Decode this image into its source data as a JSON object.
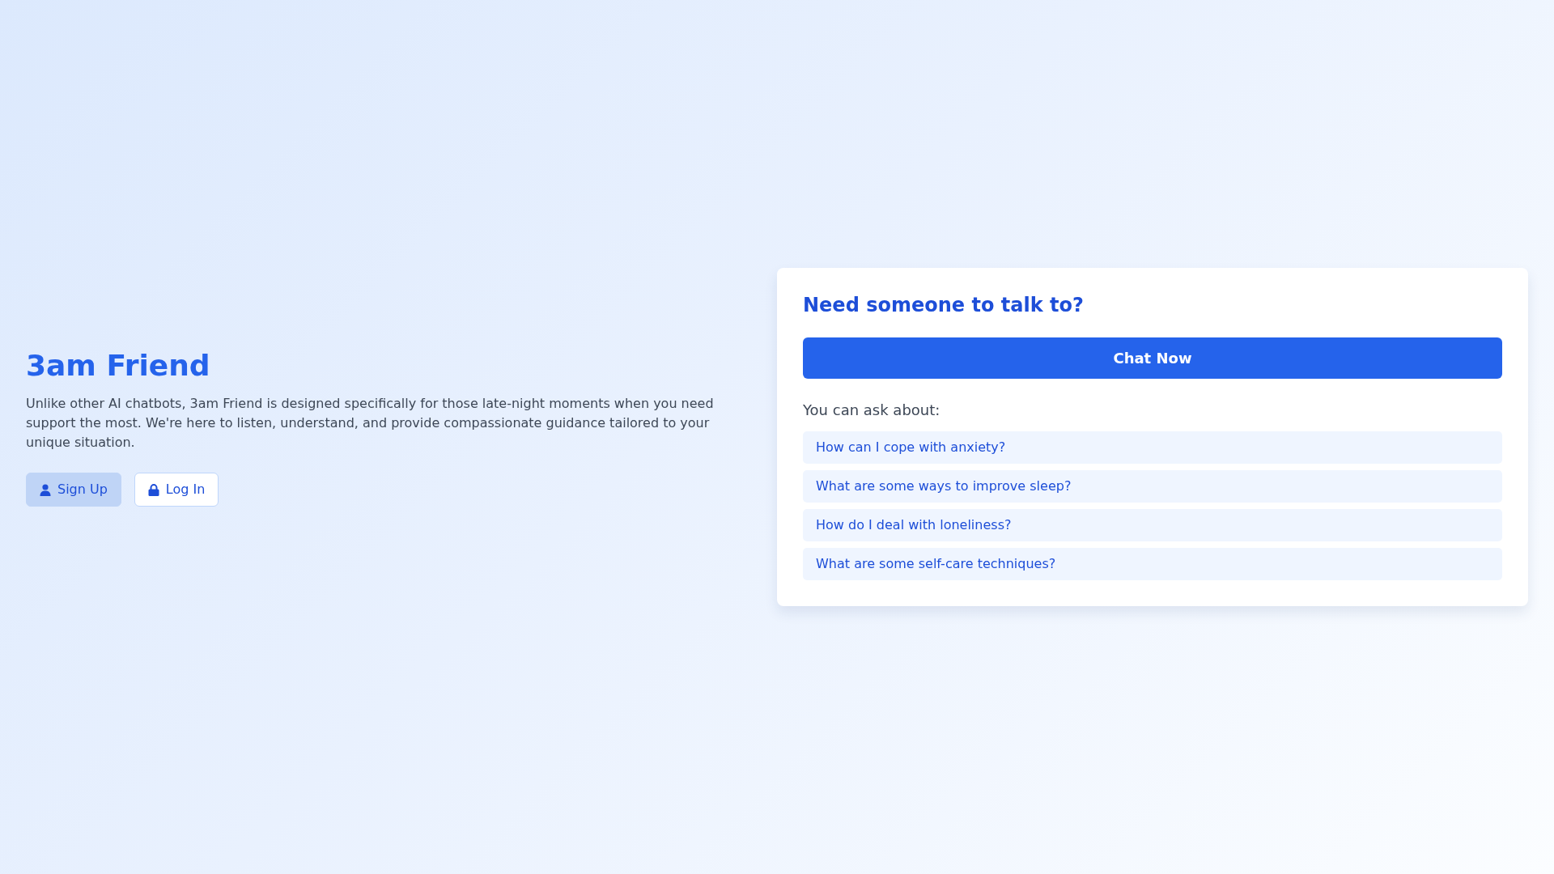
{
  "hero": {
    "title": "3am Friend",
    "description": "Unlike other AI chatbots, 3am Friend is designed specifically for those late-night moments when you need support the most. We're here to listen, understand, and provide compassionate guidance tailored to your unique situation."
  },
  "auth_buttons": [
    {
      "label": "Sign Up",
      "kind": "signup"
    },
    {
      "label": "Log In",
      "kind": "login"
    }
  ],
  "chat_card": {
    "heading": "Need someone to talk to?",
    "button": "Chat Now",
    "prompt_label": "You can ask about:",
    "suggestions": [
      "How can I cope with anxiety?",
      "What are some ways to improve sleep?",
      "How do I deal with loneliness?",
      "What are some self-care techniques?"
    ]
  }
}
